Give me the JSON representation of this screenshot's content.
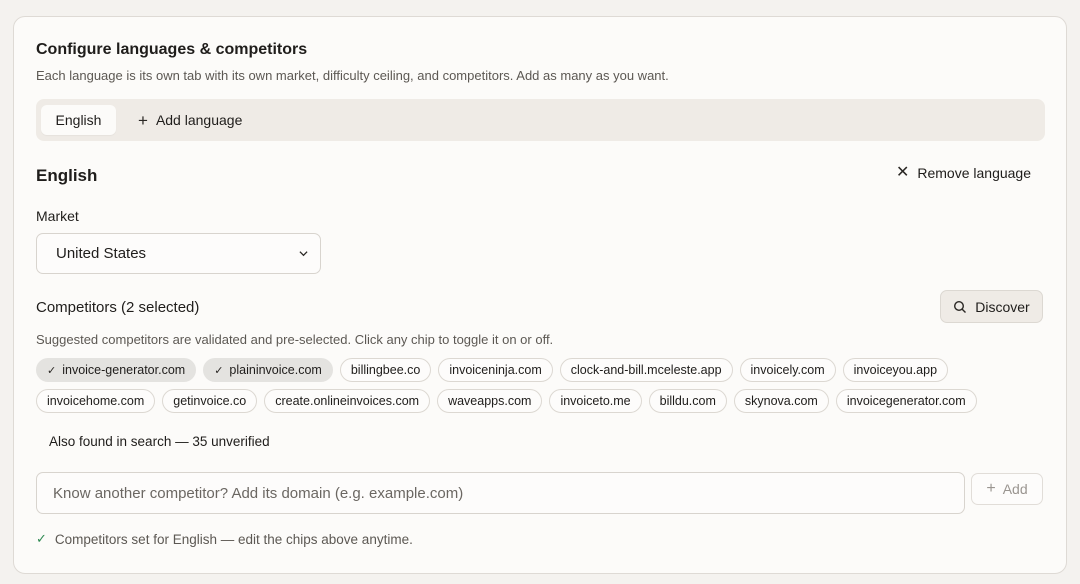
{
  "header": {
    "title": "Configure languages & competitors",
    "description": "Each language is its own tab with its own market, difficulty ceiling, and competitors. Add as many as you want."
  },
  "tabs": {
    "items": [
      {
        "label": "English",
        "active": true
      }
    ],
    "add_label": "Add language"
  },
  "language": {
    "heading": "English",
    "remove_label": "Remove language"
  },
  "market": {
    "label": "Market",
    "selected": "United States"
  },
  "competitors": {
    "label": "Competitors (2 selected)",
    "discover_label": "Discover",
    "hint": "Suggested competitors are validated and pre-selected. Click any chip to toggle it on or off.",
    "chips_row1": [
      {
        "label": "invoice-generator.com",
        "selected": true
      },
      {
        "label": "plaininvoice.com",
        "selected": true
      },
      {
        "label": "billingbee.co",
        "selected": false
      },
      {
        "label": "invoiceninja.com",
        "selected": false
      },
      {
        "label": "clock-and-bill.mceleste.app",
        "selected": false
      },
      {
        "label": "invoicely.com",
        "selected": false
      },
      {
        "label": "invoiceyou.app",
        "selected": false
      }
    ],
    "chips_row2": [
      {
        "label": "invoicehome.com",
        "selected": false
      },
      {
        "label": "getinvoice.co",
        "selected": false
      },
      {
        "label": "create.onlineinvoices.com",
        "selected": false
      },
      {
        "label": "waveapps.com",
        "selected": false
      },
      {
        "label": "invoiceto.me",
        "selected": false
      },
      {
        "label": "billdu.com",
        "selected": false
      },
      {
        "label": "skynova.com",
        "selected": false
      },
      {
        "label": "invoicegenerator.com",
        "selected": false
      }
    ],
    "also_found": "Also found in search — 35 unverified"
  },
  "add_competitor": {
    "placeholder": "Know another competitor? Add its domain (e.g. example.com)",
    "value": "",
    "button_label": "Add"
  },
  "status": {
    "text": "Competitors set for English — edit the chips above anytime."
  },
  "icons": {
    "plus": "plus-icon",
    "close": "x-icon",
    "chevron": "chevron-down-icon",
    "search": "search-icon",
    "check": "check-icon"
  },
  "colors": {
    "selected_chip": "#e4e3e0",
    "success": "#2f8a53"
  }
}
